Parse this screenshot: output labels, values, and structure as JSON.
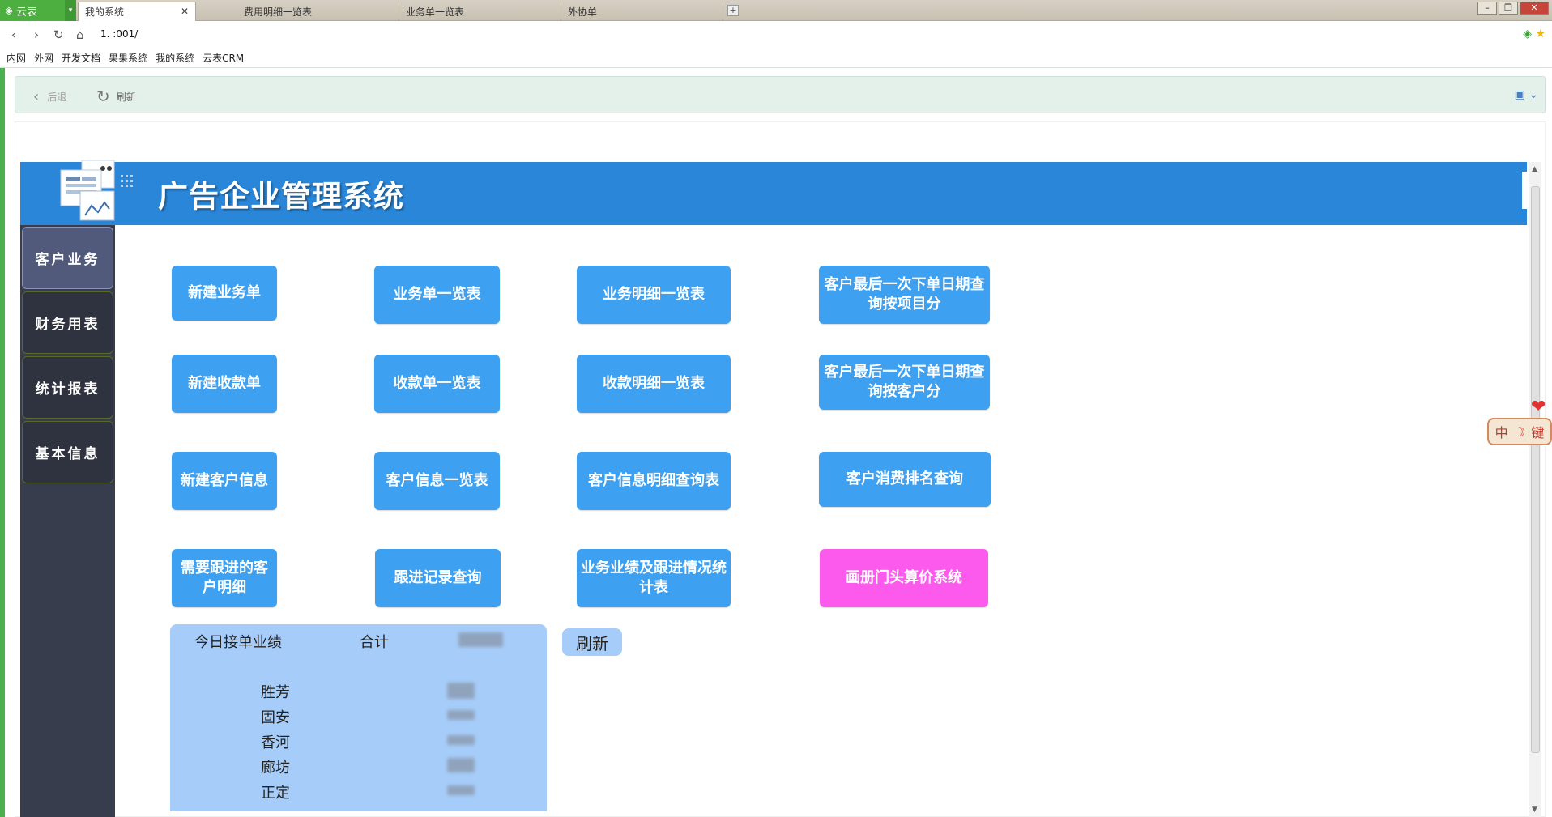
{
  "browser": {
    "app_name": "云表",
    "tabs": [
      {
        "label": "我的系统",
        "active": true
      },
      {
        "label": "费用明细一览表",
        "active": false
      },
      {
        "label": "业务单一览表",
        "active": false
      },
      {
        "label": "外协单",
        "active": false
      }
    ],
    "url": "1.              :001/",
    "bookmarks": [
      "内网",
      "外网",
      "开发文档",
      "果果系统",
      "我的系统",
      "云表CRM"
    ]
  },
  "toolbar": {
    "back_label": "后退",
    "refresh_label": "刷新"
  },
  "header": {
    "title": "广告企业管理系统",
    "color": "#2a86d8"
  },
  "sidebar": {
    "items": [
      {
        "label": "客户业务",
        "active": true
      },
      {
        "label": "财务用表",
        "active": false
      },
      {
        "label": "统计报表",
        "active": false
      },
      {
        "label": "基本信息",
        "active": false
      }
    ]
  },
  "functions": {
    "new_order": "新建业务单",
    "order_list": "业务单一览表",
    "order_detail_list": "业务明细一览表",
    "last_order_by_item": "客户最后一次下单日期查询按项目分",
    "new_receipt": "新建收款单",
    "receipt_list": "收款单一览表",
    "receipt_detail_list": "收款明细一览表",
    "last_order_by_customer": "客户最后一次下单日期查询按客户分",
    "new_customer": "新建客户信息",
    "customer_list": "客户信息一览表",
    "customer_detail_query": "客户信息明细查询表",
    "customer_ranking": "客户消费排名查询",
    "followup_customers": "需要跟进的客户明细",
    "followup_records": "跟进记录查询",
    "performance_stats": "业务业绩及跟进情况统计表",
    "album_pricing": "画册门头算价系统"
  },
  "stats": {
    "title": "今日接单业绩",
    "total_label": "合计",
    "regions": [
      "胜芳",
      "固安",
      "香河",
      "廊坊",
      "正定"
    ],
    "refresh_label": "刷新"
  },
  "ime": {
    "label_left": "中",
    "label_right": "键"
  },
  "colors": {
    "browser_accent": "#4caf3f",
    "function_button": "#3ea0f0",
    "highlight_button": "#fb5aec",
    "sidebar_bg": "#373d4c",
    "stats_panel": "#a6cdf9"
  }
}
